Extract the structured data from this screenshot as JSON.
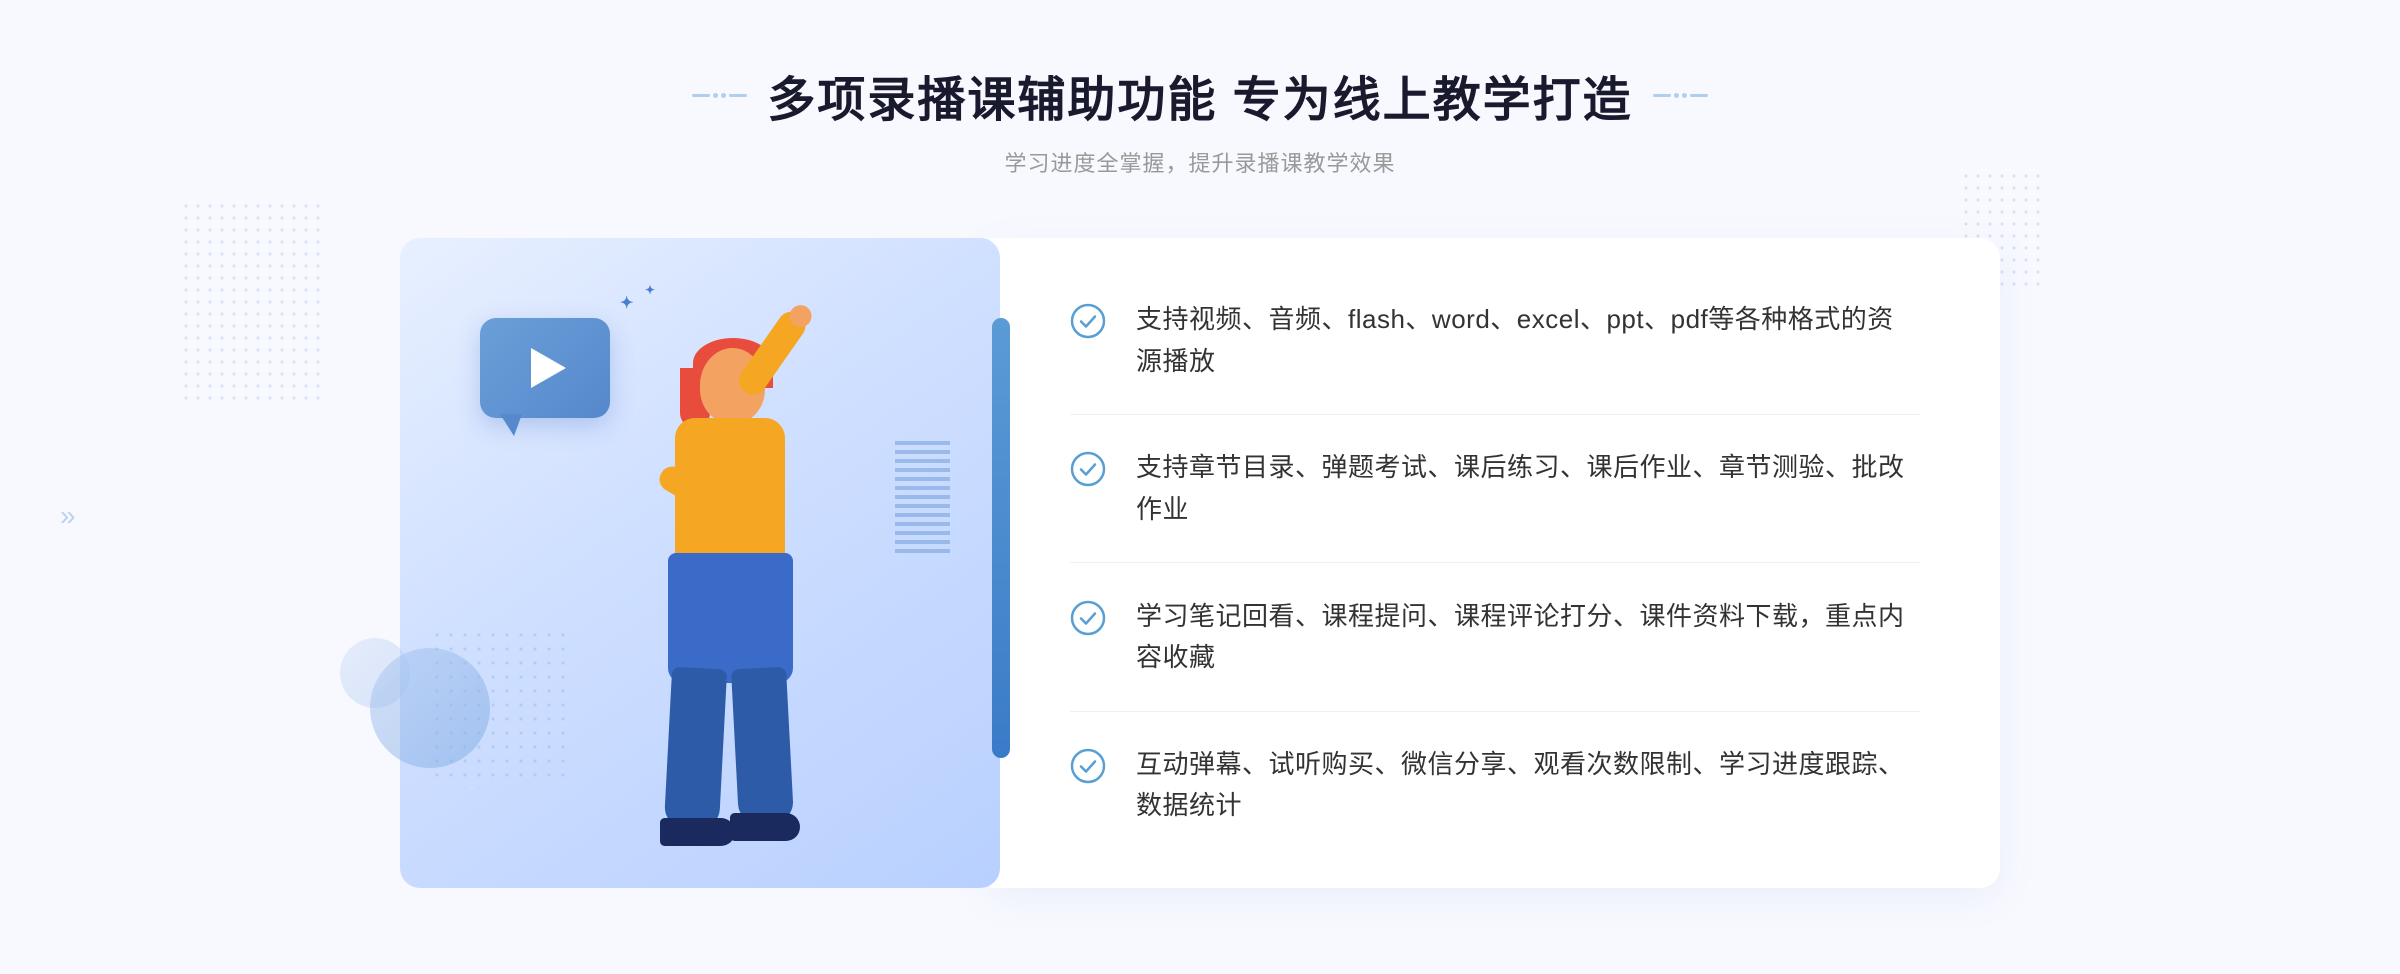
{
  "page": {
    "background_color": "#f8f9ff"
  },
  "header": {
    "title": "多项录播课辅助功能 专为线上教学打造",
    "subtitle": "学习进度全掌握，提升录播课教学效果",
    "decorator_left": "❖",
    "decorator_right": "❖"
  },
  "features": [
    {
      "id": 1,
      "text": "支持视频、音频、flash、word、excel、ppt、pdf等各种格式的资源播放"
    },
    {
      "id": 2,
      "text": "支持章节目录、弹题考试、课后练习、课后作业、章节测验、批改作业"
    },
    {
      "id": 3,
      "text": "学习笔记回看、课程提问、课程评论打分、课件资料下载，重点内容收藏"
    },
    {
      "id": 4,
      "text": "互动弹幕、试听购买、微信分享、观看次数限制、学习进度跟踪、数据统计"
    }
  ],
  "icons": {
    "check": "check-circle-icon",
    "play": "play-icon",
    "arrow": "arrow-icon"
  }
}
